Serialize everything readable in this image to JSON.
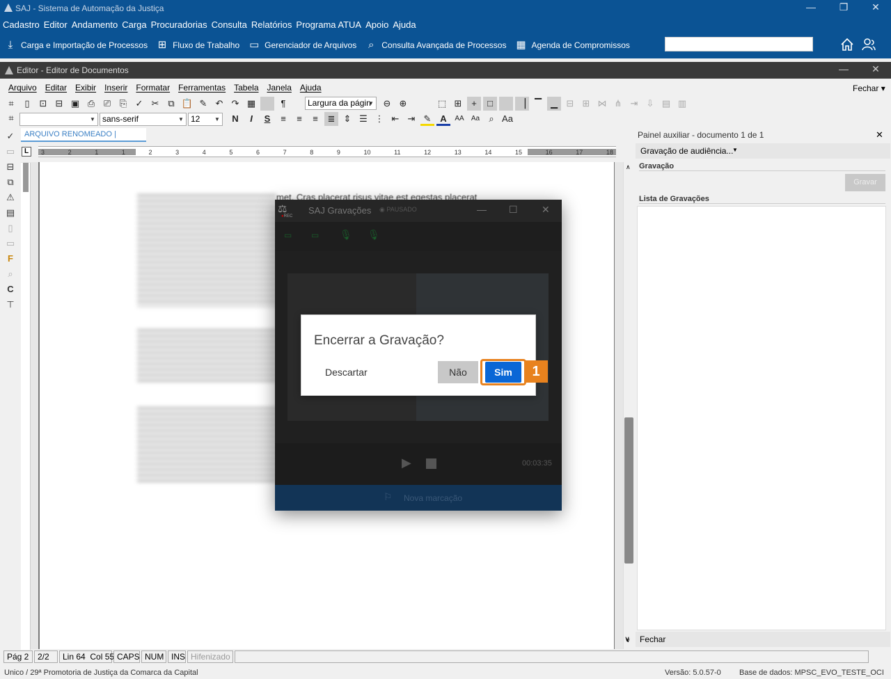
{
  "app": {
    "title": "SAJ - Sistema de Automação da Justiça",
    "menu": [
      "Cadastro",
      "Editor",
      "Andamento",
      "Carga",
      "Procuradorias",
      "Consulta",
      "Relatórios",
      "Programa ATUA",
      "Apoio",
      "Ajuda"
    ],
    "quick": [
      {
        "label": "Carga e Importação de Processos",
        "icon": "download-icon"
      },
      {
        "label": "Fluxo de Trabalho",
        "icon": "workflow-icon"
      },
      {
        "label": "Gerenciador de Arquivos",
        "icon": "folder-icon"
      },
      {
        "label": "Consulta Avançada de Processos",
        "icon": "search-folder-icon"
      },
      {
        "label": "Agenda de Compromissos",
        "icon": "calendar-icon"
      }
    ]
  },
  "editor": {
    "title": "Editor - Editor de Documentos",
    "menu": [
      "Arquivo",
      "Editar",
      "Exibir",
      "Inserir",
      "Formatar",
      "Ferramentas",
      "Tabela",
      "Janela",
      "Ajuda"
    ],
    "close_label": "Fechar",
    "zoom": "Largura da págin",
    "font": "sans-serif",
    "font_size": "12",
    "style": "",
    "doc_tab": "ARQUIVO RENOMEADO |",
    "visible_text": "met. Cras placerat risus vitae est egestas placerat"
  },
  "ruler": {
    "ticks": [
      "3",
      "2",
      "1",
      "1",
      "2",
      "3",
      "4",
      "5",
      "6",
      "7",
      "8",
      "9",
      "10",
      "11",
      "12",
      "13",
      "14",
      "15",
      "16",
      "17",
      "18"
    ]
  },
  "panel": {
    "title": "Painel auxiliar - documento 1 de 1",
    "dropdown": "Gravação de audiência...",
    "gravacao_label": "Gravação",
    "gravar_label": "Gravar",
    "lista_label": "Lista de Gravações",
    "fechar_label": "Fechar"
  },
  "recorder": {
    "title": "SAJ Gravações",
    "status": "PAUSADO",
    "rec_label": "REC",
    "time": "00:03:35",
    "marker_label": "Nova marcação"
  },
  "dialog": {
    "question": "Encerrar a Gravação?",
    "discard": "Descartar",
    "no": "Não",
    "yes": "Sim",
    "step": "1"
  },
  "status": {
    "page": "Pág 2",
    "pages": "2/2",
    "linecol": "Lin 64  Col 55",
    "caps": "CAPS",
    "num": "NUM",
    "ins": "INS",
    "hyphen": "Hifenizado"
  },
  "footer": {
    "org": "Unico / 29ª Promotoria de Justiça da Comarca da Capital",
    "version": "Versão: 5.0.57-0",
    "db": "Base de dados: MPSC_EVO_TESTE_OCI"
  },
  "colors": {
    "brand": "#0b5394",
    "accent": "#e8821e",
    "primary_button": "#0a67d6"
  }
}
